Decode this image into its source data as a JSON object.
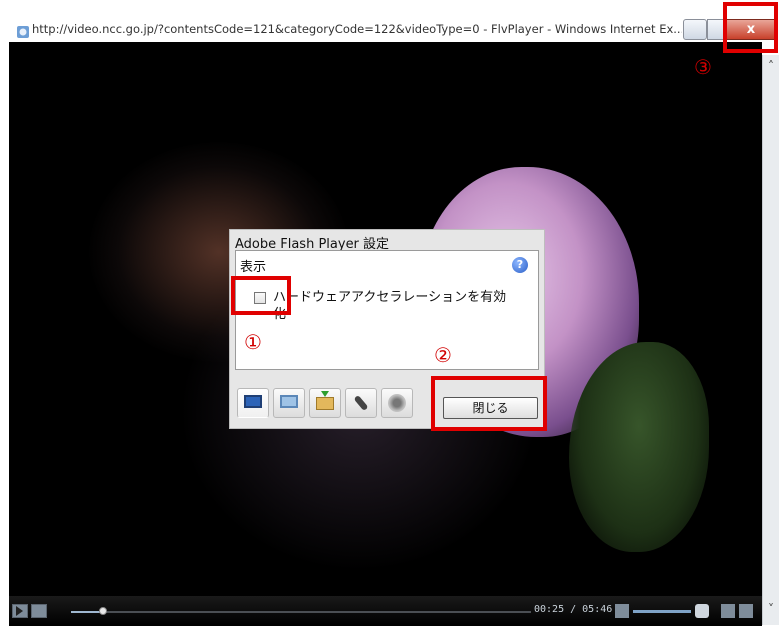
{
  "window": {
    "title": "http://video.ncc.go.jp/?contentsCode=121&categoryCode=122&videoType=0 - FlvPlayer - Windows Internet Ex...",
    "close_symbol": "x"
  },
  "player": {
    "time_display": "00:25 / 05:46",
    "progress_fraction": 0.07
  },
  "dialog": {
    "title": "Adobe Flash Player 設定",
    "section": "表示",
    "help_symbol": "?",
    "checkbox_label": "ハードウェアアクセラレーションを有効化",
    "checkbox_checked": false,
    "close_button": "閉じる",
    "tabs": [
      "display",
      "privacy",
      "local-storage",
      "microphone",
      "camera"
    ]
  },
  "scrollbar": {
    "up_symbol": "˄",
    "down_symbol": "˅"
  },
  "annotations": {
    "marker_1": "①",
    "marker_2": "②",
    "marker_3": "③",
    "color": "#e00000"
  }
}
